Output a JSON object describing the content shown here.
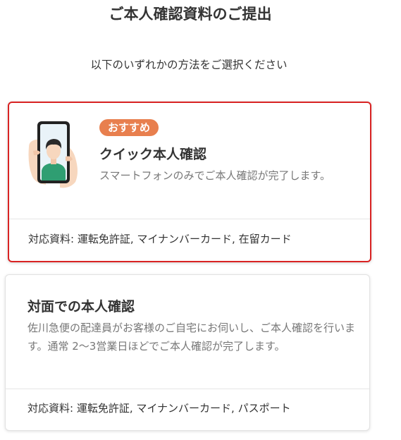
{
  "page": {
    "title": "ご本人確認資料のご提出",
    "subtitle": "以下のいずれかの方法をご選択ください"
  },
  "options": [
    {
      "badge": "おすすめ",
      "title": "クイック本人確認",
      "description": "スマートフォンのみでご本人確認が完了します。",
      "documents": "対応資料: 運転免許証, マイナンバーカード, 在留カード",
      "illustration_icon": "smartphone-selfie-icon",
      "selected": true
    },
    {
      "title": "対面での本人確認",
      "description": "佐川急便の配達員がお客様のご自宅にお伺いし、ご本人確認を行います。通常 2～3営業日ほどでご本人確認が完了します。",
      "documents": "対応資料: 運転免許証, マイナンバーカード, パスポート",
      "selected": false
    }
  ],
  "colors": {
    "selected_border": "#d92323",
    "badge_bg": "#e87f4e",
    "badge_text": "#ffffff",
    "text_main": "#333333",
    "text_muted": "#777777",
    "phone_body": "#222222",
    "skin": "#f7d7be",
    "shirt": "#2f9e72"
  }
}
